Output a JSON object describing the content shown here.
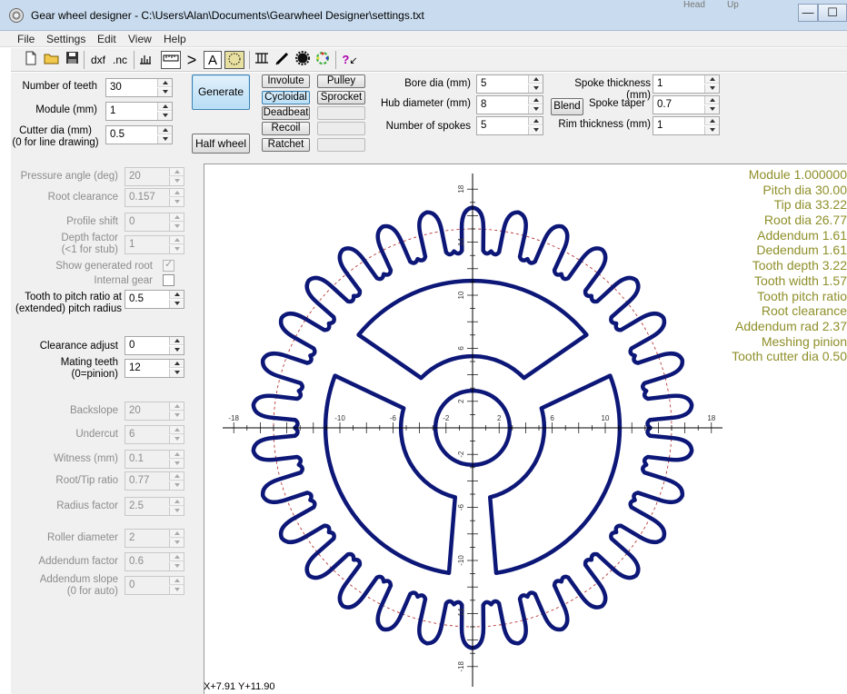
{
  "window": {
    "title": "Gear wheel designer - C:\\Users\\Alan\\Documents\\Gearwheel Designer\\settings.txt",
    "minimize": "—",
    "maximize": "☐",
    "background_text_1": "Head",
    "background_text_2": "Up"
  },
  "menu": [
    "File",
    "Settings",
    "Edit",
    "View",
    "Help"
  ],
  "toolbar": {
    "dxf": "dxf",
    "nc": ".nc",
    "text_a": "A",
    "help": "?"
  },
  "top_fields": {
    "teeth_label": "Number of teeth",
    "teeth": "30",
    "module_label": "Module (mm)",
    "module": "1",
    "cutter_label": "Cutter dia (mm)",
    "cutter_sub": "(0 for line drawing)",
    "cutter": "0.5",
    "bore_label": "Bore dia (mm)",
    "bore": "5",
    "hub_label": "Hub diameter (mm)",
    "hub": "8",
    "spokes_label": "Number of spokes",
    "spokes": "5",
    "spoke_thick_label": "Spoke thickness (mm)",
    "spoke_thick": "1",
    "spoke_taper_label": "Spoke taper",
    "spoke_taper": "0.7",
    "rim_label": "Rim thickness (mm)",
    "rim": "1"
  },
  "buttons": {
    "generate": "Generate",
    "half_wheel": "Half wheel",
    "involute": "Involute",
    "cycloidal": "Cycloidal",
    "deadbeat": "Deadbeat",
    "recoil": "Recoil",
    "ratchet": "Ratchet",
    "pulley": "Pulley",
    "sprocket": "Sprocket",
    "blend": "Blend"
  },
  "left_fields": {
    "pressure_label": "Pressure angle (deg)",
    "pressure": "20",
    "root_clear_label": "Root clearance",
    "root_clear": "0.157",
    "profile_label": "Profile shift",
    "profile": "0",
    "depth_label": "Depth factor",
    "depth_sub": "(<1 for stub)",
    "depth": "1",
    "show_root_label": "Show generated root",
    "internal_label": "Internal gear",
    "ratio_label": "Tooth to pitch ratio at",
    "ratio_sub": "(extended) pitch radius",
    "ratio": "0.5",
    "clear_adj_label": "Clearance adjust",
    "clear_adj": "0",
    "mating_label": "Mating teeth",
    "mating_sub": "(0=pinion)",
    "mating": "12",
    "backslope_label": "Backslope",
    "backslope": "20",
    "undercut_label": "Undercut",
    "undercut": "6",
    "witness_label": "Witness (mm)",
    "witness": "0.1",
    "root_tip_label": "Root/Tip ratio",
    "root_tip": "0.77",
    "radius_label": "Radius factor",
    "radius": "2.5",
    "roller_label": "Roller diameter",
    "roller": "2",
    "add_factor_label": "Addendum factor",
    "add_factor": "0.6",
    "add_slope_label": "Addendum slope",
    "add_slope_sub": "(0 for auto)",
    "add_slope": "0"
  },
  "stats": [
    "Module 1.000000",
    "Pitch dia 30.00",
    "Tip dia 33.22",
    "Root dia 26.77",
    "Addendum 1.61",
    "Dedendum 1.61",
    "Tooth depth 3.22",
    "Tooth width 1.57",
    "Tooth pitch ratio",
    "Root clearance",
    "Addendum rad 2.37",
    "Meshing pinion",
    "Tooth cutter dia 0.50"
  ],
  "axis": {
    "x_ticks": [
      "-18",
      "-10",
      "-6",
      "-2",
      "2",
      "6",
      "10",
      "18"
    ],
    "y_ticks": [
      "18",
      "14",
      "10",
      "6",
      "2",
      "-2",
      "-6",
      "-10",
      "-14",
      "-18"
    ]
  },
  "colors": {
    "gear": "#0c1777",
    "pitch_circle": "#b02020",
    "axis": "#000000",
    "stats": "#8f8f2a"
  },
  "status": {
    "coord": "X+7.91 Y+11.90"
  }
}
